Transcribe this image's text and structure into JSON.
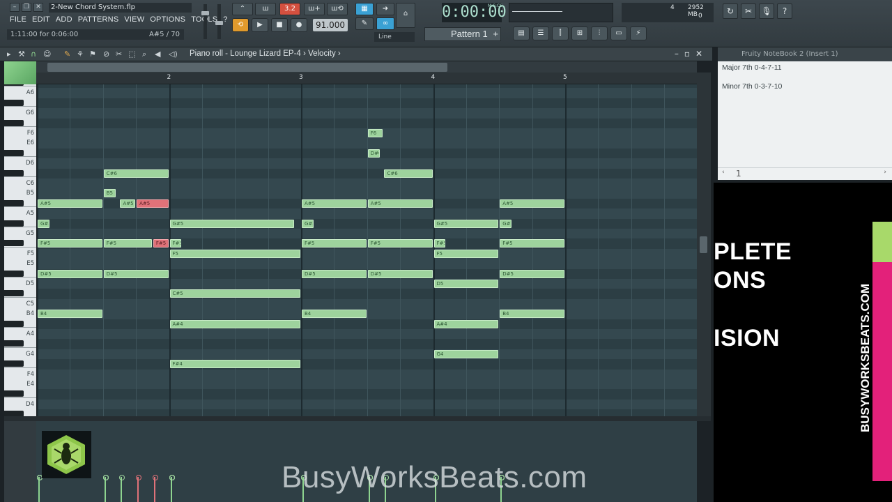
{
  "window": {
    "project_title": "2-New Chord System.flp"
  },
  "menu": [
    "FILE",
    "EDIT",
    "ADD",
    "PATTERNS",
    "VIEW",
    "OPTIONS",
    "TOOLS",
    "?"
  ],
  "hint_bar": {
    "left": "1:11:00 for 0:06:00",
    "right": "A#5 / 70"
  },
  "toolbar": {
    "step_label": "3.2",
    "tempo": "91.000",
    "time": "0:00:00",
    "time_unit": "M:S:CS",
    "pattern_label": "Pattern 1",
    "snap_label": "Line",
    "cpu_value": "4",
    "ram_value": "2952 MB",
    "poly_value": "0"
  },
  "piano_roll": {
    "title": "Piano roll - Lounge Lizard EP-4",
    "target": "Velocity",
    "bars": [
      "2",
      "3",
      "4",
      "5"
    ],
    "key_labels": [
      "A6",
      "G6",
      "F6",
      "E6",
      "D6",
      "C6",
      "B5",
      "A5",
      "G5",
      "F5",
      "E5",
      "D5",
      "C5",
      "B4",
      "A4",
      "G4",
      "F4",
      "E4",
      "D4"
    ]
  },
  "notes": [
    {
      "pitch": "C#6",
      "start": 1.5,
      "len": 0.5,
      "sel": false
    },
    {
      "pitch": "B5",
      "start": 1.5,
      "len": 0.1,
      "sel": false
    },
    {
      "pitch": "A#5",
      "start": 1.0,
      "len": 0.5,
      "sel": false
    },
    {
      "pitch": "A#5",
      "start": 1.625,
      "len": 0.125,
      "sel": false
    },
    {
      "pitch": "A#5",
      "start": 1.75,
      "len": 0.25,
      "sel": true
    },
    {
      "pitch": "G#5",
      "start": 1.0,
      "len": 0.1,
      "sel": false
    },
    {
      "pitch": "F#5",
      "start": 1.0,
      "len": 0.5,
      "sel": false
    },
    {
      "pitch": "F#5",
      "start": 1.5,
      "len": 0.375,
      "sel": false
    },
    {
      "pitch": "F#5",
      "start": 1.875,
      "len": 0.125,
      "sel": true
    },
    {
      "pitch": "D#5",
      "start": 1.0,
      "len": 0.5,
      "sel": false
    },
    {
      "pitch": "D#5",
      "start": 1.5,
      "len": 0.5,
      "sel": false
    },
    {
      "pitch": "B4",
      "start": 1.0,
      "len": 0.5,
      "sel": false
    },
    {
      "pitch": "G#5",
      "start": 2.0,
      "len": 0.95,
      "sel": false
    },
    {
      "pitch": "F#5",
      "start": 2.0,
      "len": 0.1,
      "sel": false
    },
    {
      "pitch": "F5",
      "start": 2.0,
      "len": 1.0,
      "sel": false
    },
    {
      "pitch": "C#5",
      "start": 2.0,
      "len": 1.0,
      "sel": false
    },
    {
      "pitch": "A#4",
      "start": 2.0,
      "len": 1.0,
      "sel": false
    },
    {
      "pitch": "F#4",
      "start": 2.0,
      "len": 1.0,
      "sel": false
    },
    {
      "pitch": "F6",
      "start": 3.5,
      "len": 0.125,
      "sel": false
    },
    {
      "pitch": "D#6",
      "start": 3.5,
      "len": 0.1,
      "sel": false
    },
    {
      "pitch": "C#6",
      "start": 3.625,
      "len": 0.375,
      "sel": false
    },
    {
      "pitch": "A#5",
      "start": 3.0,
      "len": 0.5,
      "sel": false
    },
    {
      "pitch": "A#5",
      "start": 3.5,
      "len": 0.5,
      "sel": false
    },
    {
      "pitch": "G#5",
      "start": 3.0,
      "len": 0.1,
      "sel": false
    },
    {
      "pitch": "F#5",
      "start": 3.0,
      "len": 0.5,
      "sel": false
    },
    {
      "pitch": "F#5",
      "start": 3.5,
      "len": 0.5,
      "sel": false
    },
    {
      "pitch": "D#5",
      "start": 3.0,
      "len": 0.5,
      "sel": false
    },
    {
      "pitch": "D#5",
      "start": 3.5,
      "len": 0.5,
      "sel": false
    },
    {
      "pitch": "B4",
      "start": 3.0,
      "len": 0.5,
      "sel": false
    },
    {
      "pitch": "G#5",
      "start": 4.0,
      "len": 0.5,
      "sel": false
    },
    {
      "pitch": "F#5",
      "start": 4.0,
      "len": 0.1,
      "sel": false
    },
    {
      "pitch": "F5",
      "start": 4.0,
      "len": 0.5,
      "sel": false
    },
    {
      "pitch": "D5",
      "start": 4.0,
      "len": 0.5,
      "sel": false
    },
    {
      "pitch": "A#4",
      "start": 4.0,
      "len": 0.5,
      "sel": false
    },
    {
      "pitch": "G4",
      "start": 4.0,
      "len": 0.5,
      "sel": false
    },
    {
      "pitch": "A#5",
      "start": 4.5,
      "len": 0.5,
      "sel": false
    },
    {
      "pitch": "G#5",
      "start": 4.5,
      "len": 0.1,
      "sel": false
    },
    {
      "pitch": "F#5",
      "start": 4.5,
      "len": 0.5,
      "sel": false
    },
    {
      "pitch": "D#5",
      "start": 4.5,
      "len": 0.5,
      "sel": false
    },
    {
      "pitch": "B4",
      "start": 4.5,
      "len": 0.5,
      "sel": false
    }
  ],
  "notebook": {
    "title": "Fruity NoteBook 2 (Insert 1)",
    "lines": [
      "Major 7th 0-4-7-11",
      "Minor 7th 0-3-7-10"
    ],
    "page": "1"
  },
  "promo": {
    "lines": [
      "PLETE",
      "ONS",
      "ISION"
    ],
    "box_text": "BUSYWORKSBEATS.COM",
    "colors": {
      "box_side": "#e3217a",
      "box_top": "#a8d96a"
    }
  },
  "watermark": "BusyWorksBeats.com",
  "colors": {
    "note": "#9ed39d",
    "note_selected": "#e07279",
    "grid": "#34484f",
    "accent_orange": "#e09a2c",
    "accent_blue": "#3aa1d4"
  }
}
